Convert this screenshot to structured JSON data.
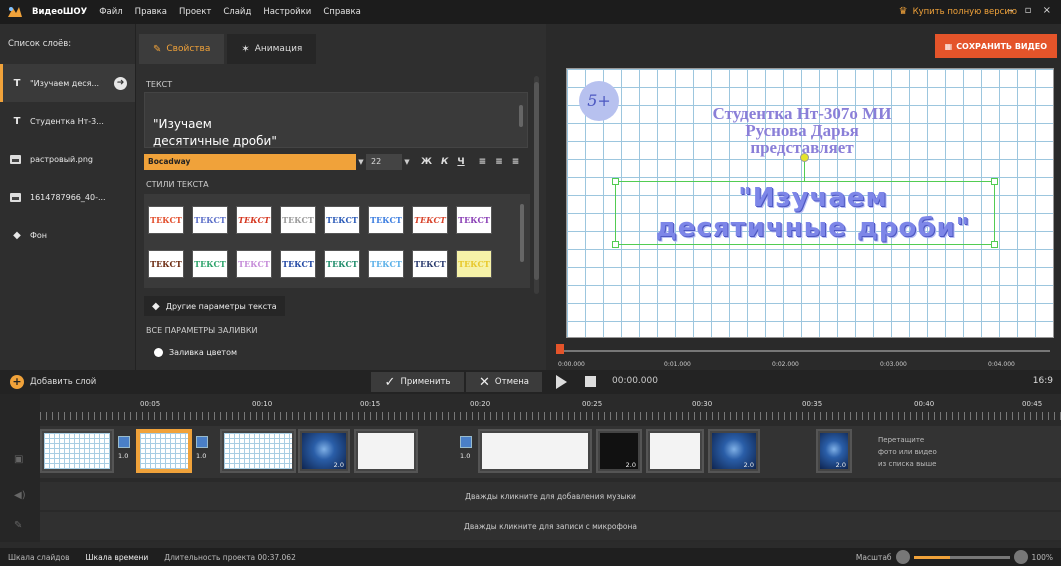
{
  "menu": {
    "app": "ВидеоШОУ",
    "items": [
      "Файл",
      "Правка",
      "Проект",
      "Слайд",
      "Настройки",
      "Справка"
    ],
    "buy": "Купить полную версию",
    "window_controls": "– ▫ ×"
  },
  "layers": {
    "header": "Список слоёв:",
    "items": [
      {
        "label": "\"Изучаем деся...",
        "icon": "text-icon"
      },
      {
        "label": "Студентка Нт-3...",
        "icon": "text-icon"
      },
      {
        "label": "растровый.png",
        "icon": "image-icon"
      },
      {
        "label": "1614787966_40-...",
        "icon": "image-icon"
      },
      {
        "label": "Фон",
        "icon": "fill-bucket-icon"
      }
    ]
  },
  "props": {
    "tab_properties": "Свойства",
    "tab_animation": "Анимация",
    "text_section": "ТЕКСТ",
    "text_value": "\"Изучаем\nдесятичные дроби\"",
    "font": "Bocadway",
    "size": "22",
    "bold": "Ж",
    "italic": "К",
    "underline": "Ч",
    "styles_section": "СТИЛИ ТЕКСТА",
    "style_label": "ТЕКСТ",
    "more_params": "Другие параметры текста",
    "fill_section": "ВСЕ ПАРАМЕТРЫ ЗАЛИВКИ",
    "fill_color": "Заливка цветом"
  },
  "preview": {
    "save_button": "СОХРАНИТЬ ВИДЕО",
    "badge": "5+",
    "line1": "Студентка Нт-307о МИ",
    "line2": "Руснова Дарья",
    "line3": "представляет",
    "big1": "\"Изучаем",
    "big2": "десятичные дроби\"",
    "ruler_ticks": [
      "0:00.000",
      "0:01.000",
      "0:02.000",
      "0:03.000",
      "0:04.000"
    ]
  },
  "controls": {
    "add_layer": "Добавить слой",
    "apply": "Применить",
    "cancel": "Отмена",
    "timecode": "00:00.000",
    "ratio": "16:9"
  },
  "timeline": {
    "ticks": [
      "00:05",
      "00:10",
      "00:15",
      "00:20",
      "00:25",
      "00:30",
      "00:35",
      "00:40",
      "00:45"
    ],
    "transitions": [
      "1.0",
      "1.0",
      "2.0",
      "1.0",
      "2.0",
      "2.0",
      "2.0"
    ],
    "drop_hint_1": "Перетащите",
    "drop_hint_2": "фото или видео",
    "drop_hint_3": "из списка выше",
    "music_hint": "Дважды кликните для добавления музыки",
    "mic_hint": "Дважды кликните для записи с микрофона"
  },
  "status": {
    "tab1": "Шкала слайдов",
    "tab2": "Шкала времени",
    "duration": "Длительность проекта 00:37.062",
    "zoom_label": "Масштаб",
    "zoom_value": "100%"
  },
  "colors": {
    "accent": "#f0a23a",
    "save": "#e4542a",
    "title_purple": "#8a7fd8",
    "big_text": "#7d86e8"
  }
}
